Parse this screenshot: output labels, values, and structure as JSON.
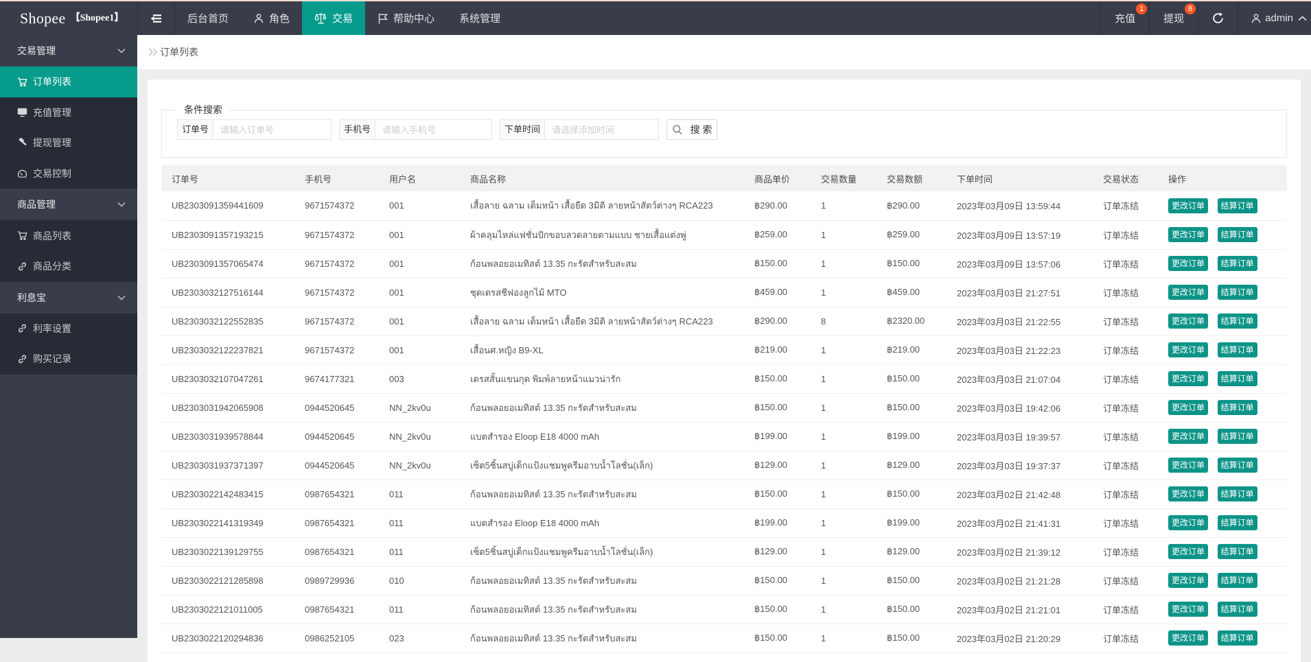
{
  "colors": {
    "accent": "#079b8c",
    "button": "#0d9488",
    "badge": "#ff5722",
    "header_bg": "#393d49",
    "submenu_bg": "#272b35",
    "page_bg": "#ededed",
    "top_strip": "#f8dbd0"
  },
  "header": {
    "logo": "Shopee",
    "logo_sub": "【Shopee1】",
    "nav": [
      {
        "label": "后台首页",
        "icon": null
      },
      {
        "label": "角色",
        "icon": "person"
      },
      {
        "label": "交易",
        "icon": "scales",
        "active": true
      },
      {
        "label": "帮助中心",
        "icon": "flag"
      },
      {
        "label": "系统管理",
        "icon": null
      }
    ],
    "right": {
      "recharge": {
        "label": "充值",
        "badge": "1"
      },
      "withdraw": {
        "label": "提现",
        "badge": "8"
      },
      "refresh_icon": "refresh",
      "user": {
        "icon": "person",
        "name": "admin",
        "caret": "chevron-up"
      }
    }
  },
  "sidebar": {
    "groups": [
      {
        "label": "交易管理",
        "items": [
          {
            "label": "订单列表",
            "icon": "cart",
            "active": true
          },
          {
            "label": "充值管理",
            "icon": "board",
            "active": false
          },
          {
            "label": "提现管理",
            "icon": "gavel",
            "active": false
          },
          {
            "label": "交易控制",
            "icon": "gauge",
            "active": false
          }
        ]
      },
      {
        "label": "商品管理",
        "items": [
          {
            "label": "商品列表",
            "icon": "cart",
            "active": false
          },
          {
            "label": "商品分类",
            "icon": "link",
            "active": false
          }
        ]
      },
      {
        "label": "利息宝",
        "items": [
          {
            "label": "利率设置",
            "icon": "link",
            "active": false
          },
          {
            "label": "购买记录",
            "icon": "link",
            "active": false
          }
        ]
      }
    ]
  },
  "breadcrumb": {
    "current": "订单列表"
  },
  "search": {
    "legend": "条件搜索",
    "fields": [
      {
        "label": "订单号",
        "placeholder": "请输入订单号",
        "value": ""
      },
      {
        "label": "手机号",
        "placeholder": "请输入手机号",
        "value": ""
      },
      {
        "label": "下单时间",
        "placeholder": "请选择添加时间",
        "value": ""
      }
    ],
    "button_label": "搜 索"
  },
  "table": {
    "headers": [
      "订单号",
      "手机号",
      "用户名",
      "商品名称",
      "商品单价",
      "交易数量",
      "交易数额",
      "下单时间",
      "交易状态",
      "操作"
    ],
    "action_labels": {
      "edit": "更改订单",
      "settle": "结算订单"
    },
    "rows": [
      {
        "order_id": "UB2303091359441609",
        "phone": "9671574372",
        "username": "001",
        "product": "เสื้อลาย ฉลาม เต็มหน้า เสื้อยืด 3มิติ ลายหน้าสัตว์ต่างๆ RCA223",
        "unit_price": "฿290.00",
        "quantity": "1",
        "amount": "฿290.00",
        "time": "2023年03月09日 13:59:44",
        "status": "订单冻结"
      },
      {
        "order_id": "UB2303091357193215",
        "phone": "9671574372",
        "username": "001",
        "product": "ผ้าคลุมไหล่แฟชั่นปักขอบลวดลายตามแบบ ชายเสื้อแต่งพู่",
        "unit_price": "฿259.00",
        "quantity": "1",
        "amount": "฿259.00",
        "time": "2023年03月09日 13:57:19",
        "status": "订单冻结"
      },
      {
        "order_id": "UB2303091357065474",
        "phone": "9671574372",
        "username": "001",
        "product": "ก้อนพลอยอเมทิสต์ 13.35 กะรัตสำหรับสะสม",
        "unit_price": "฿150.00",
        "quantity": "1",
        "amount": "฿150.00",
        "time": "2023年03月09日 13:57:06",
        "status": "订单冻结"
      },
      {
        "order_id": "UB2303032127516144",
        "phone": "9671574372",
        "username": "001",
        "product": "ชุดเดรสชีฟองลูกไม้ MTO",
        "unit_price": "฿459.00",
        "quantity": "1",
        "amount": "฿459.00",
        "time": "2023年03月03日 21:27:51",
        "status": "订单冻结"
      },
      {
        "order_id": "UB2303032122552835",
        "phone": "9671574372",
        "username": "001",
        "product": "เสื้อลาย ฉลาม เต็มหน้า เสื้อยืด 3มิติ ลายหน้าสัตว์ต่างๆ RCA223",
        "unit_price": "฿290.00",
        "quantity": "8",
        "amount": "฿2320.00",
        "time": "2023年03月03日 21:22:55",
        "status": "订单冻结"
      },
      {
        "order_id": "UB2303032122237821",
        "phone": "9671574372",
        "username": "001",
        "product": "เสื้อนศ.หญิง B9-XL",
        "unit_price": "฿219.00",
        "quantity": "1",
        "amount": "฿219.00",
        "time": "2023年03月03日 21:22:23",
        "status": "订单冻结"
      },
      {
        "order_id": "UB2303032107047261",
        "phone": "9674177321",
        "username": "003",
        "product": "เดรสสั้นแขนกุด พิมพ์ลายหน้าแมวน่ารัก",
        "unit_price": "฿150.00",
        "quantity": "1",
        "amount": "฿150.00",
        "time": "2023年03月03日 21:07:04",
        "status": "订单冻结"
      },
      {
        "order_id": "UB2303031942065908",
        "phone": "0944520645",
        "username": "NN_2kv0u",
        "product": "ก้อนพลอยอเมทิสต์ 13.35 กะรัตสำหรับสะสม",
        "unit_price": "฿150.00",
        "quantity": "1",
        "amount": "฿150.00",
        "time": "2023年03月03日 19:42:06",
        "status": "订单冻结"
      },
      {
        "order_id": "UB2303031939578844",
        "phone": "0944520645",
        "username": "NN_2kv0u",
        "product": "แบตสำรอง Eloop E18 4000 mAh",
        "unit_price": "฿199.00",
        "quantity": "1",
        "amount": "฿199.00",
        "time": "2023年03月03日 19:39:57",
        "status": "订单冻结"
      },
      {
        "order_id": "UB2303031937371397",
        "phone": "0944520645",
        "username": "NN_2kv0u",
        "product": "เซ็ต5ชิ้นสบู่เด็กแป้งแชมพูครีมอาบน้ำโลชั่น(เล็ก)",
        "unit_price": "฿129.00",
        "quantity": "1",
        "amount": "฿129.00",
        "time": "2023年03月03日 19:37:37",
        "status": "订单冻结"
      },
      {
        "order_id": "UB2303022142483415",
        "phone": "0987654321",
        "username": "011",
        "product": "ก้อนพลอยอเมทิสต์ 13.35 กะรัตสำหรับสะสม",
        "unit_price": "฿150.00",
        "quantity": "1",
        "amount": "฿150.00",
        "time": "2023年03月02日 21:42:48",
        "status": "订单冻结"
      },
      {
        "order_id": "UB2303022141319349",
        "phone": "0987654321",
        "username": "011",
        "product": "แบตสำรอง Eloop E18 4000 mAh",
        "unit_price": "฿199.00",
        "quantity": "1",
        "amount": "฿199.00",
        "time": "2023年03月02日 21:41:31",
        "status": "订单冻结"
      },
      {
        "order_id": "UB2303022139129755",
        "phone": "0987654321",
        "username": "011",
        "product": "เซ็ต5ชิ้นสบู่เด็กแป้งแชมพูครีมอาบน้ำโลชั่น(เล็ก)",
        "unit_price": "฿129.00",
        "quantity": "1",
        "amount": "฿129.00",
        "time": "2023年03月02日 21:39:12",
        "status": "订单冻结"
      },
      {
        "order_id": "UB2303022121285898",
        "phone": "0989729936",
        "username": "010",
        "product": "ก้อนพลอยอเมทิสต์ 13.35 กะรัตสำหรับสะสม",
        "unit_price": "฿150.00",
        "quantity": "1",
        "amount": "฿150.00",
        "time": "2023年03月02日 21:21:28",
        "status": "订单冻结"
      },
      {
        "order_id": "UB2303022121011005",
        "phone": "0987654321",
        "username": "011",
        "product": "ก้อนพลอยอเมทิสต์ 13.35 กะรัตสำหรับสะสม",
        "unit_price": "฿150.00",
        "quantity": "1",
        "amount": "฿150.00",
        "time": "2023年03月02日 21:21:01",
        "status": "订单冻结"
      },
      {
        "order_id": "UB2303022120294836",
        "phone": "0986252105",
        "username": "023",
        "product": "ก้อนพลอยอเมทิสต์ 13.35 กะรัตสำหรับสะสม",
        "unit_price": "฿150.00",
        "quantity": "1",
        "amount": "฿150.00",
        "time": "2023年03月02日 21:20:29",
        "status": "订单冻结"
      }
    ]
  }
}
